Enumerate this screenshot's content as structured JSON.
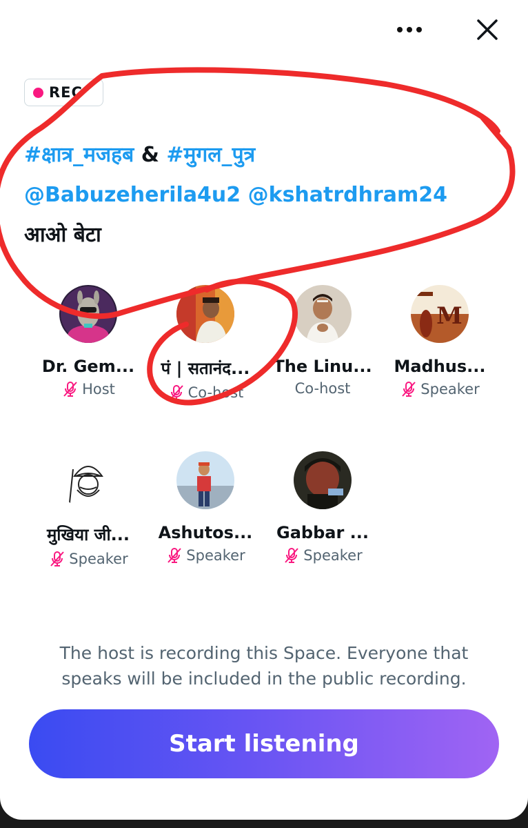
{
  "header": {
    "more_icon": "more-horizontal-icon",
    "close_icon": "close-icon"
  },
  "rec_badge": {
    "label": "REC",
    "dot_color": "#f91880"
  },
  "title": {
    "line1_tag1": "#क्षात्र_मजहब",
    "line1_amp": " & ",
    "line1_tag2": "#मुगल_पुत्र",
    "line2_mention1": "@Babuzeherila4u2",
    "line2_space": " ",
    "line2_mention2": "@kshatrdhram24",
    "line3_text": "आओ बेटा"
  },
  "participants": [
    {
      "name": "Dr. Gem...",
      "role": "Host",
      "muted": true
    },
    {
      "name": "पं | सतानंद...",
      "role": "Co-host",
      "muted": true
    },
    {
      "name": "The Linu...",
      "role": "Co-host",
      "muted": false
    },
    {
      "name": "Madhus...",
      "role": "Speaker",
      "muted": true
    },
    {
      "name": "मुखिया जी...",
      "role": "Speaker",
      "muted": true
    },
    {
      "name": "Ashutos...",
      "role": "Speaker",
      "muted": true
    },
    {
      "name": "Gabbar ...",
      "role": "Speaker",
      "muted": true
    }
  ],
  "notice": "The host is recording this Space. Everyone that speaks will be included in the public recording.",
  "start_button": {
    "label": "Start listening"
  },
  "colors": {
    "link": "#1d9bf0",
    "muted_icon": "#f91880",
    "secondary_text": "#536471",
    "annotation": "#ee2b2b"
  }
}
